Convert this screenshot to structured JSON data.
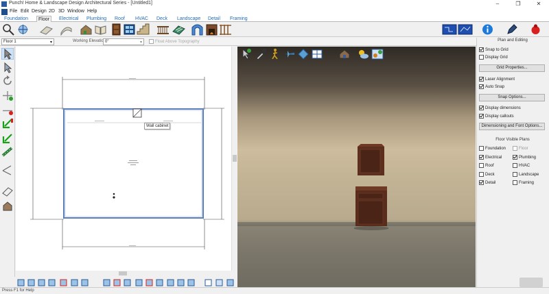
{
  "window": {
    "title": "Punch! Home & Landscape Design Architectural Series - [Untitled1]",
    "controls": [
      "–",
      "❐",
      "✕"
    ]
  },
  "menu": [
    "File",
    "Edit",
    "Design",
    "2D",
    "3D",
    "Window",
    "Help"
  ],
  "tabs": [
    "Foundation",
    "Floor",
    "Electrical",
    "Plumbing",
    "Roof",
    "HVAC",
    "Deck",
    "Landscape",
    "Detail",
    "Framing"
  ],
  "active_tab": "Floor",
  "options_bar": {
    "floor": "Floor 1",
    "working_elevation_label": "Working Elevation:",
    "working_elevation_value": "0\"",
    "float_label": "Float Above Topography"
  },
  "plan": {
    "tooltip": "Wall cabinet",
    "room_label_line1": "Bedroom",
    "room_label_line2": "15'-0\" x 12'-0\"",
    "room_label_line3": "180 ft²"
  },
  "right_panel": {
    "header": "Plan and Editing",
    "snap_to_grid": "Snap to Grid",
    "display_grid": "Display Grid",
    "grid_properties": "Grid Properties...",
    "laser_alignment": "Laser Alignment",
    "auto_snap": "Auto Snap",
    "snap_options": "Snap Options...",
    "display_dimensions": "Display dimensions",
    "display_callouts": "Display callouts",
    "dim_font_options": "Dimensioning and Font Options...",
    "visible_plans_header": "Floor Visible Plans",
    "plans": {
      "foundation": "Foundation",
      "floor": "Floor",
      "electrical": "Electrical",
      "plumbing": "Plumbing",
      "roof": "Roof",
      "hvac": "HVAC",
      "deck": "Deck",
      "landscape": "Landscape",
      "detail": "Detail",
      "framing": "Framing"
    }
  },
  "status": "Press F1 for Help",
  "colors": {
    "tab_link": "#1e6bb8",
    "wall_blue": "#5b7fb8",
    "cabinet": "#5c2e1e"
  }
}
